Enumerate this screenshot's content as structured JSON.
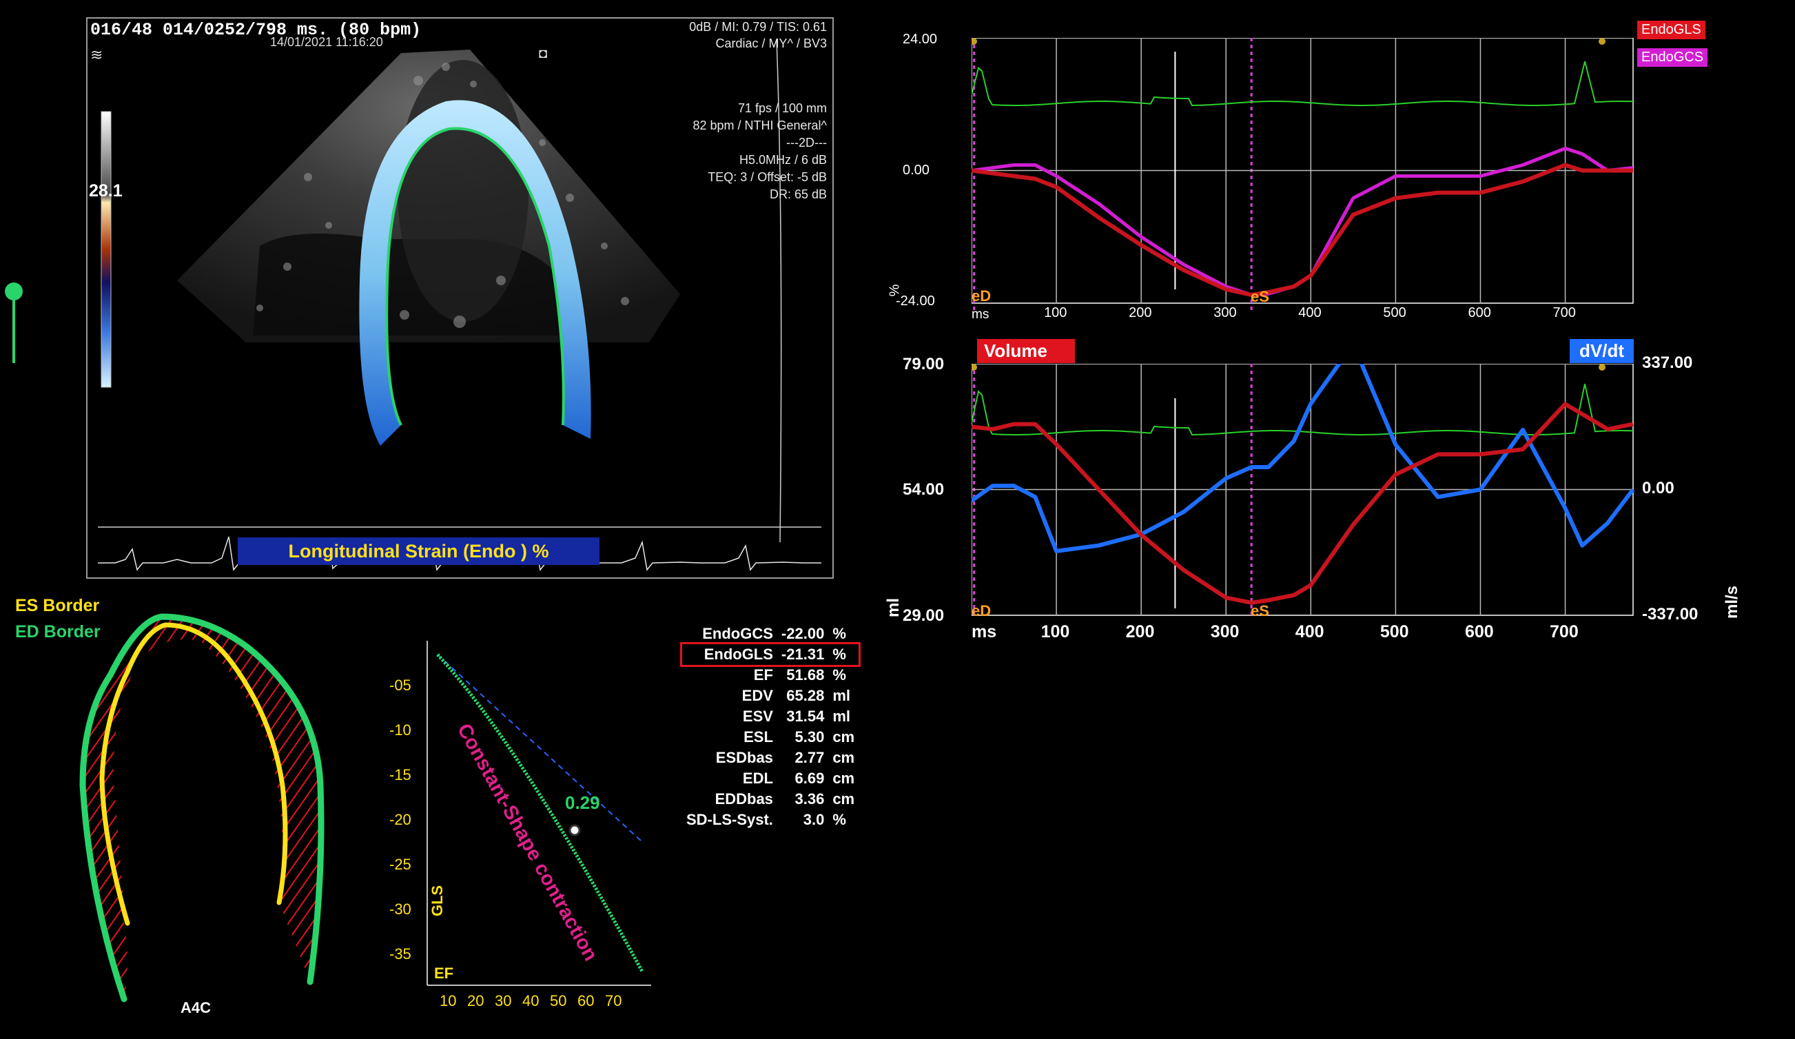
{
  "echo": {
    "header_left": "016/48  014/0252/798 ms.  (80 bpm)",
    "header_date": "14/01/2021 11:16:20",
    "header_right_1": "0dB / MI: 0.79 / TIS: 0.61",
    "header_right_2": "Cardiac / MY^ / BV3",
    "settings": [
      "71 fps / 100 mm",
      "82 bpm / NTHI General^",
      "---2D---",
      "H5.0MHz / 6 dB",
      "TEQ: 3 / Offset: -5 dB",
      "DR: 65 dB"
    ],
    "gain_value": "28.1",
    "strain_label": "Longitudinal Strain (Endo ) %",
    "hr_icon": "≋",
    "probe_icon": "◘"
  },
  "borders": {
    "es_label": "ES Border",
    "ed_label": "ED Border",
    "view_label": "A4C",
    "es_color": "#ffe11a",
    "ed_color": "#29d46a",
    "hatch_color": "#e0141e"
  },
  "gls_ef_plot": {
    "y_ticks": [
      "-05",
      "-10",
      "-15",
      "-20",
      "-25",
      "-30",
      "-35"
    ],
    "x_ticks": [
      "10",
      "20",
      "30",
      "40",
      "50",
      "60",
      "70"
    ],
    "y_label": "GLS",
    "x_label": "EF",
    "annotation": "Constant-Shape contraction",
    "point_value": "0.29",
    "point": {
      "ef": 51.68,
      "gls": -21.31
    }
  },
  "measurements": [
    {
      "key": "EndoGCS",
      "value": "-22.00",
      "unit": "%"
    },
    {
      "key": "EndoGLS",
      "value": "-21.31",
      "unit": "%"
    },
    {
      "key": "EF",
      "value": "51.68",
      "unit": "%"
    },
    {
      "key": "EDV",
      "value": "65.28",
      "unit": "ml"
    },
    {
      "key": "ESV",
      "value": "31.54",
      "unit": "ml"
    },
    {
      "key": "ESL",
      "value": "5.30",
      "unit": "cm"
    },
    {
      "key": "ESDbas",
      "value": "2.77",
      "unit": "cm"
    },
    {
      "key": "EDL",
      "value": "6.69",
      "unit": "cm"
    },
    {
      "key": "EDDbas",
      "value": "3.36",
      "unit": "cm"
    },
    {
      "key": "SD-LS-Syst.",
      "value": "3.0",
      "unit": "%"
    }
  ],
  "strain_chart": {
    "y_top": "24.00",
    "y_mid": "0.00",
    "y_bot": "-24.00",
    "y_unit": "%",
    "x_unit": "ms",
    "x_ticks": [
      "100",
      "200",
      "300",
      "400",
      "500",
      "600",
      "700"
    ],
    "marker_ed": "eD",
    "marker_es": "eS",
    "legend": [
      {
        "name": "EndoGLS",
        "color": "#e0141e"
      },
      {
        "name": "EndoGCS",
        "color": "#d21ed2"
      }
    ]
  },
  "volume_chart": {
    "y_top": "79.00",
    "y_mid": "54.00",
    "y_bot": "29.00",
    "y_unit": "ml",
    "y2_top": "337.00",
    "y2_mid": "0.00",
    "y2_bot": "-337.00",
    "y2_unit": "ml/s",
    "x_unit": "ms",
    "x_ticks": [
      "100",
      "200",
      "300",
      "400",
      "500",
      "600",
      "700"
    ],
    "marker_ed": "eD",
    "marker_es": "eS",
    "badge_left": "Volume",
    "badge_right": "dV/dt",
    "volume_color": "#e0141e",
    "dvdt_color": "#1e6eff"
  },
  "chart_data": [
    {
      "type": "line",
      "x": [
        0,
        25,
        50,
        75,
        100,
        150,
        200,
        250,
        300,
        330,
        350,
        380,
        400,
        450,
        500,
        550,
        600,
        650,
        700,
        720,
        750,
        780
      ],
      "series": [
        {
          "name": "EndoGLS",
          "values": [
            0,
            -0.5,
            -1,
            -1.5,
            -3,
            -8.5,
            -13.5,
            -18,
            -21.5,
            -22.5,
            -22,
            -21,
            -19,
            -8,
            -5,
            -4,
            -4,
            -2,
            1,
            0,
            0,
            0
          ]
        },
        {
          "name": "EndoGCS",
          "values": [
            0,
            0.5,
            1,
            1,
            -1,
            -6,
            -12,
            -17,
            -21,
            -22.5,
            -22.3,
            -21,
            -19,
            -5,
            -1,
            -1,
            -1,
            1,
            4,
            3,
            0,
            0.5
          ]
        }
      ],
      "ylim": [
        -24,
        24
      ],
      "xlim": [
        0,
        780
      ]
    },
    {
      "type": "line",
      "x": [
        0,
        25,
        50,
        75,
        100,
        150,
        200,
        250,
        300,
        330,
        350,
        380,
        400,
        450,
        500,
        550,
        600,
        650,
        700,
        720,
        750,
        780
      ],
      "series": [
        {
          "name": "Volume",
          "axis": "left",
          "values": [
            66.5,
            66,
            67,
            67,
            63,
            54,
            45,
            38,
            32.5,
            31.5,
            32,
            33,
            35,
            47,
            57,
            61,
            61,
            62,
            71,
            69,
            66,
            67
          ]
        },
        {
          "name": "dV/dt",
          "axis": "right",
          "values": [
            -30,
            10,
            10,
            -20,
            -165,
            -150,
            -120,
            -60,
            30,
            60,
            60,
            130,
            230,
            390,
            120,
            -20,
            0,
            160,
            -50,
            -150,
            -90,
            0
          ]
        }
      ],
      "ylim": [
        29,
        79
      ],
      "y2lim": [
        -337,
        337
      ],
      "xlim": [
        0,
        780
      ]
    }
  ]
}
